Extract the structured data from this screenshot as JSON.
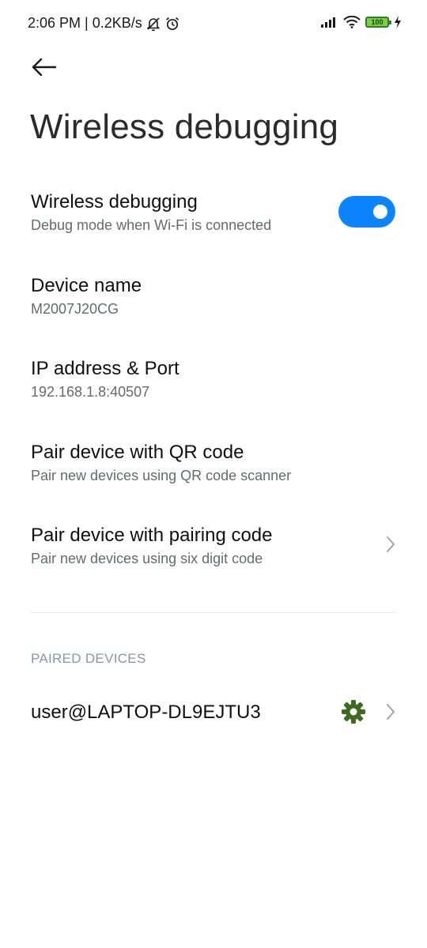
{
  "status_bar": {
    "time_speed": "2:06 PM | 0.2KB/s",
    "battery_level": "100",
    "icons": [
      "muted-bell-icon",
      "alarm-icon",
      "signal-icon",
      "wifi-icon",
      "battery-icon",
      "charging-icon"
    ]
  },
  "header": {
    "back_icon": "back-arrow-icon",
    "title": "Wireless debugging"
  },
  "settings": {
    "wireless": {
      "title": "Wireless debugging",
      "subtitle": "Debug mode when Wi-Fi is connected",
      "enabled": true
    },
    "device_name": {
      "title": "Device name",
      "value": "M2007J20CG"
    },
    "ip_port": {
      "title": "IP address & Port",
      "value": "192.168.1.8:40507"
    },
    "pair_qr": {
      "title": "Pair device with QR code",
      "subtitle": "Pair new devices using QR code scanner"
    },
    "pair_code": {
      "title": "Pair device with pairing code",
      "subtitle": "Pair new devices using six digit code"
    }
  },
  "paired_devices": {
    "header": "PAIRED DEVICES",
    "items": [
      {
        "name": "user@LAPTOP-DL9EJTU3"
      }
    ]
  },
  "colors": {
    "accent": "#0d84ff",
    "gear": "#3d6b1f",
    "battery": "#7bd136"
  }
}
